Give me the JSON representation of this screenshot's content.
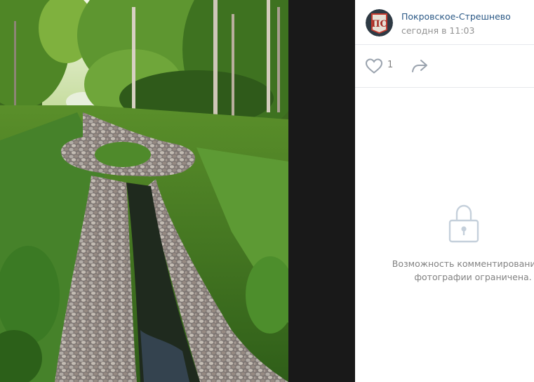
{
  "author": {
    "name": "Покровское-Стрешнево",
    "date": "сегодня в 11:03",
    "avatar_label": "ПС"
  },
  "actions": {
    "like_count": "1",
    "like_icon": "heart-icon",
    "share_icon": "share-arrow-icon"
  },
  "comments": {
    "lock_icon": "lock-icon",
    "restricted_line1": "Возможность комментирования эт",
    "restricted_line2": "фотографии ограничена."
  },
  "colors": {
    "link": "#2a5885",
    "muted": "#939393",
    "icon": "#99a2ad",
    "divider": "#e7e8ec"
  }
}
